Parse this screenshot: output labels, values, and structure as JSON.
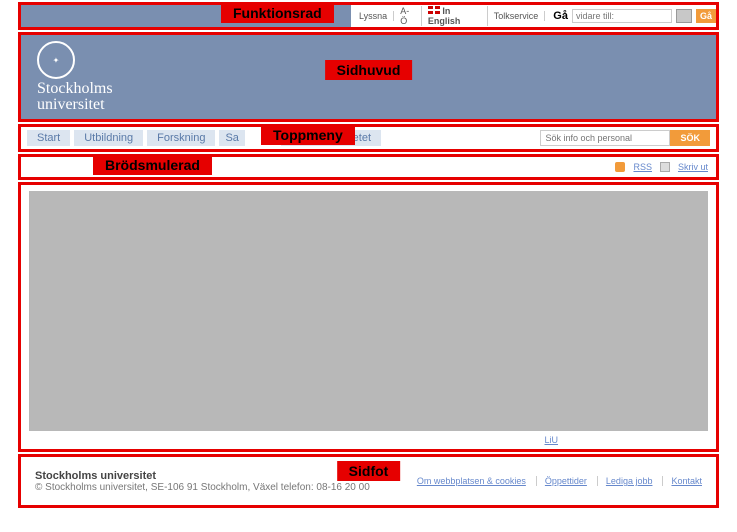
{
  "labels": {
    "funcbar": "Funktionsrad",
    "header": "Sidhuvud",
    "topmenu": "Toppmeny",
    "breadcrumb": "Brödsmulerad",
    "footer": "Sidfot"
  },
  "funcbar": {
    "links": [
      "Lyssna",
      "A-Ö"
    ],
    "english": "In English",
    "tolk": "Tolkservice",
    "goto_prefix": "Gå",
    "goto_placeholder": "vidare till:",
    "go_btn": "Gå"
  },
  "header": {
    "uni_line1": "Stockholms",
    "uni_line2": "universitet"
  },
  "topmenu": {
    "items": [
      "Start",
      "Utbildning",
      "Forskning",
      "Sa"
    ],
    "item_after": "Om universitetet",
    "search_placeholder": "Sök info och personal",
    "search_btn": "SÖK"
  },
  "breadcrumb": {
    "rss": "RSS",
    "print": "Skriv ut"
  },
  "content": {
    "link": "LiU"
  },
  "footer": {
    "title": "Stockholms universitet",
    "copyright": "© Stockholms universitet, SE-106 91 Stockholm, Växel telefon: 08-16 20 00",
    "links": [
      "Om webbplatsen & cookies",
      "Öppettider",
      "Lediga jobb",
      "Kontakt"
    ]
  }
}
